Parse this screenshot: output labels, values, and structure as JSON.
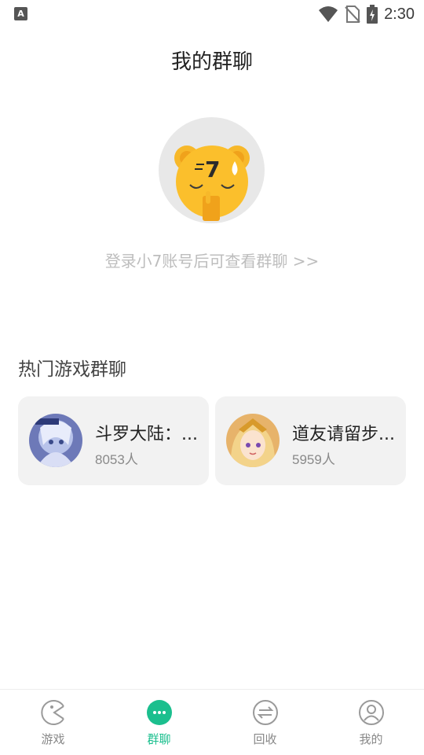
{
  "status_bar": {
    "time": "2:30",
    "left_icon": "A"
  },
  "header": {
    "title": "我的群聊"
  },
  "login": {
    "hint": "登录小7账号后可查看群聊 >>"
  },
  "hot_section": {
    "title": "热门游戏群聊",
    "groups": [
      {
        "name": "斗罗大陆：...",
        "count": "8053人"
      },
      {
        "name": "道友请留步...",
        "count": "5959人"
      }
    ]
  },
  "tabbar": {
    "active_color": "#1bbf8e",
    "items": [
      {
        "label": "游戏",
        "icon": "pacman-icon"
      },
      {
        "label": "群聊",
        "icon": "chat-bubble-icon"
      },
      {
        "label": "回收",
        "icon": "exchange-icon"
      },
      {
        "label": "我的",
        "icon": "user-icon"
      }
    ]
  }
}
